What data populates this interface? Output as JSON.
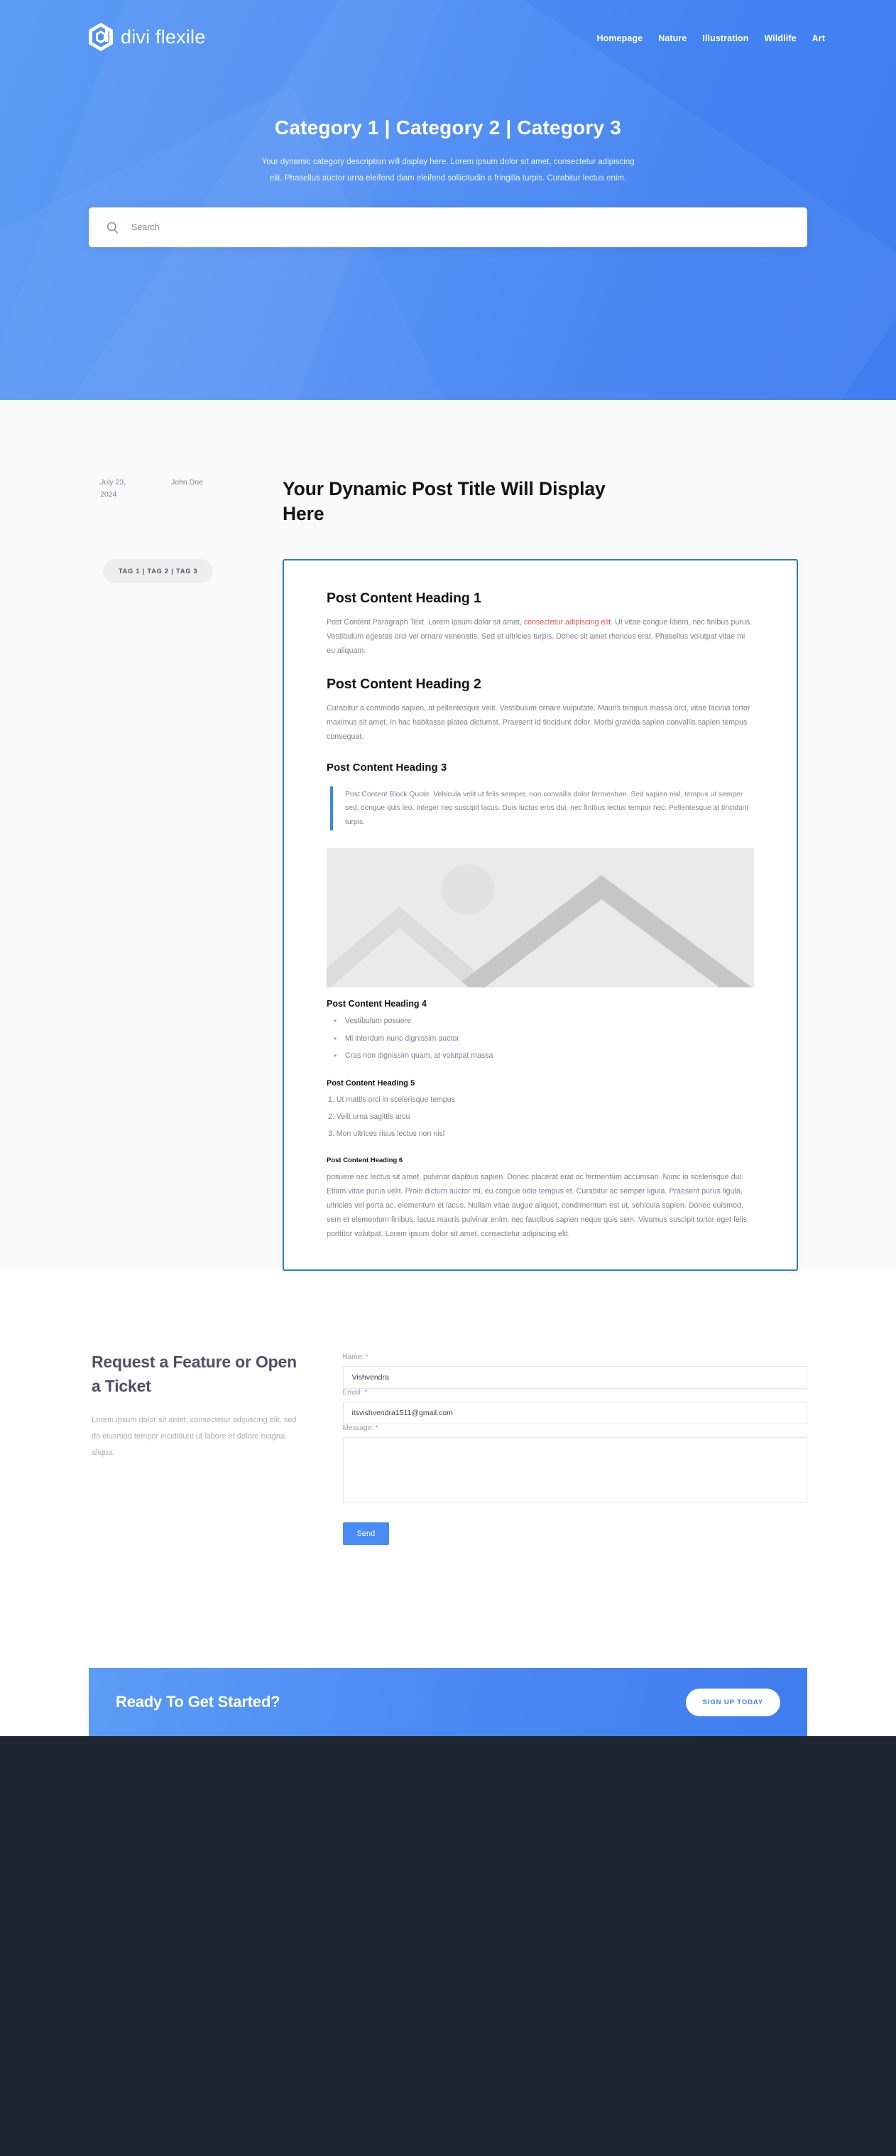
{
  "brand": {
    "name": "divi flexile",
    "logo_icon": "hexagon-d-logo-icon"
  },
  "nav": {
    "items": [
      {
        "label": "Homepage"
      },
      {
        "label": "Nature"
      },
      {
        "label": "Illustration"
      },
      {
        "label": "Wildlife"
      },
      {
        "label": "Art"
      }
    ]
  },
  "hero": {
    "title": "Category 1 | Category 2 | Category 3",
    "description": "Your dynamic category description will display here. Lorem ipsum dolor sit amet, consectetur adipiscing elit. Phasellus auctor urna eleifend diam eleifend sollicitudin a fringilla turpis. Curabitur lectus enim.",
    "search_placeholder": "Search",
    "search_value": "",
    "search_icon": "search-icon"
  },
  "post": {
    "date": "July 23, 2024",
    "author": "John Doe",
    "tags": "TAG 1 | TAG 2 | TAG 3",
    "title": "Your Dynamic Post Title Will Display Here",
    "heading1": "Post Content Heading 1",
    "para1_before": "Post Content Paragraph Text. Lorem ipsum dolor sit amet, ",
    "para1_link": "consectetur adipiscing elit",
    "para1_after": ". Ut vitae congue libero, nec finibus purus. Vestibulum egestas orci vel ornare venenatis. Sed et ultricies turpis. Donec sit amet rhoncus erat. Phasellus volutpat vitae mi eu aliquam.",
    "heading2": "Post Content Heading 2",
    "para2": "Curabitur a commodo sapien, at pellentesque velit. Vestibulum ornare vulputate. Mauris tempus massa orci, vitae lacinia tortor maximus sit amet. In hac habitasse platea dictumst. Praesent id tincidunt dolor. Morbi gravida sapien convallis sapien tempus consequat.",
    "heading3": "Post Content Heading 3",
    "blockquote": "Post Content Block Quote. Vehicula velit ut felis semper, non convallis dolor fermentum. Sed sapien nisl, tempus ut semper sed, congue quis leo. Integer nec suscipit lacus. Duis luctus eros dui, nec finibus lectus tempor nec. Pellentesque at tincidunt turpis.",
    "image_icon": "image-placeholder-icon",
    "heading4": "Post Content Heading 4",
    "bullets": [
      "Vestibulum posuere",
      "Mi interdum nunc dignissim auctor",
      "Cras non dignissim quam, at volutpat massa"
    ],
    "heading5": "Post Content Heading 5",
    "numbers": [
      "Ut mattis orci in scelerisque tempus",
      "Velit urna sagittis arcu",
      "Mon ultrices risus lectus non nisl"
    ],
    "heading6": "Post Content Heading 6",
    "para6": "posuere nec lectus sit amet, pulvinar dapibus sapien. Donec placerat erat ac fermentum accumsan. Nunc in scelerisque dui. Etiam vitae purus velit. Proin dictum auctor mi, eu congue odio tempus et. Curabitur ac semper ligula. Praesent purus ligula, ultricies vel porta ac, elementum et lacus. Nullam vitae augue aliquet, condimentum est ut, vehicula sapien. Donec euismod, sem et elementum finibus, lacus mauris pulvinar enim, nec faucibus sapien neque quis sem. Vivamus suscipit tortor eget felis porttitor volutpat. Lorem ipsum dolor sit amet, consectetur adipiscing elit."
  },
  "form": {
    "heading": "Request a Feature or Open a Ticket",
    "description": "Lorem ipsum dolor sit amet, consectetur adipiscing elit, sed do eiusmod tempor incididunt ut labore et dolore magna aliqua.",
    "name_label": "Name: *",
    "name_value": "Vishvendra",
    "email_label": "Email: *",
    "email_value": "itsvishvendra1511@gmail.com",
    "message_label": "Message: *",
    "message_value": "",
    "send_label": "Send"
  },
  "cta": {
    "heading": "Ready To Get Started?",
    "button_label": "SIGN UP TODAY"
  },
  "colors": {
    "brand_blue": "#4a88f3",
    "hero_gradient_start": "#5c9cf5",
    "hero_gradient_end": "#3f7df0",
    "card_border": "#2b7cb9",
    "link_red": "#e0564e",
    "quote_bar": "#3b86e8",
    "footer_dark": "#1f2431",
    "heading_slate": "#4c5068"
  }
}
